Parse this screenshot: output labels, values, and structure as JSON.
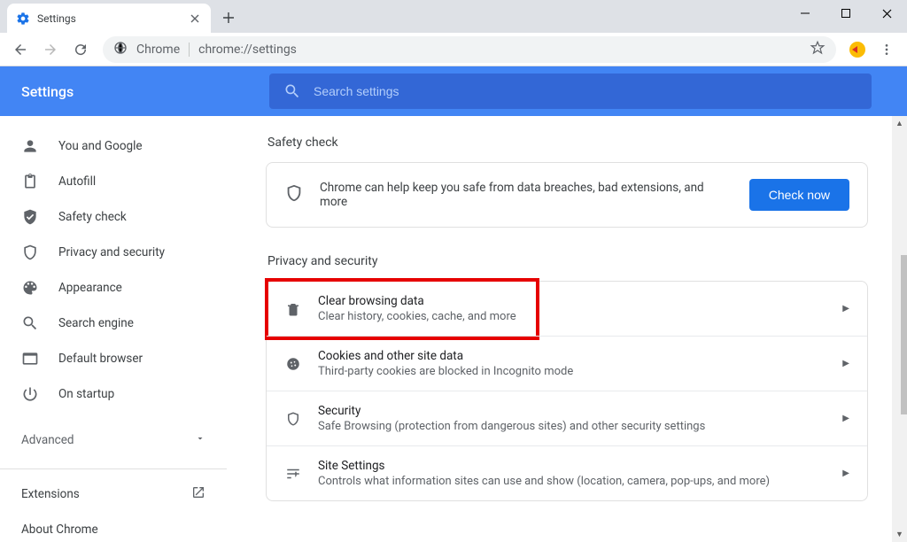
{
  "window": {
    "tab_title": "Settings"
  },
  "toolbar": {
    "site_label": "Chrome",
    "url": "chrome://settings"
  },
  "header": {
    "app_title": "Settings",
    "search_placeholder": "Search settings"
  },
  "sidebar": {
    "items": [
      {
        "label": "You and Google"
      },
      {
        "label": "Autofill"
      },
      {
        "label": "Safety check"
      },
      {
        "label": "Privacy and security"
      },
      {
        "label": "Appearance"
      },
      {
        "label": "Search engine"
      },
      {
        "label": "Default browser"
      },
      {
        "label": "On startup"
      }
    ],
    "advanced_label": "Advanced",
    "extensions_label": "Extensions",
    "about_label": "About Chrome"
  },
  "main": {
    "safety": {
      "section_title": "Safety check",
      "text": "Chrome can help keep you safe from data breaches, bad extensions, and more",
      "button": "Check now"
    },
    "privacy": {
      "section_title": "Privacy and security",
      "rows": [
        {
          "title": "Clear browsing data",
          "sub": "Clear history, cookies, cache, and more"
        },
        {
          "title": "Cookies and other site data",
          "sub": "Third-party cookies are blocked in Incognito mode"
        },
        {
          "title": "Security",
          "sub": "Safe Browsing (protection from dangerous sites) and other security settings"
        },
        {
          "title": "Site Settings",
          "sub": "Controls what information sites can use and show (location, camera, pop-ups, and more)"
        }
      ]
    }
  }
}
